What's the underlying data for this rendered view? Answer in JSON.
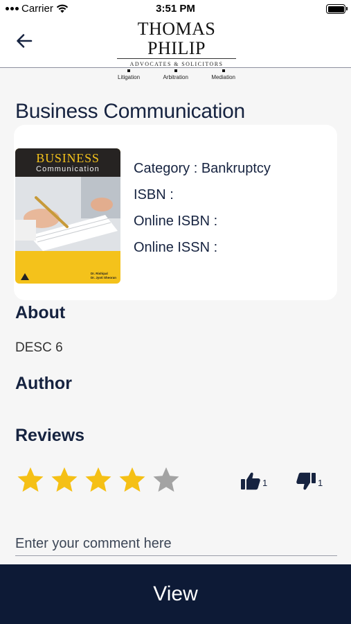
{
  "status_bar": {
    "carrier": "Carrier",
    "time": "3:51 PM"
  },
  "header": {
    "logo": {
      "name_first": "Thomas",
      "name_last": "Philip",
      "subtitle": "ADVOCATES & SOLICITORS",
      "services": [
        "Litigation",
        "Arbitration",
        "Mediation"
      ]
    },
    "back_icon": "arrow-left-icon"
  },
  "book": {
    "title": "Business Communication",
    "cover": {
      "title": "BUSINESS",
      "subtitle": "Communication",
      "author1": "Dr. Rishipal",
      "author2": "Dr. Jyoti Sheoran"
    },
    "category_line": "Category : Bankruptcy",
    "isbn_label": "ISBN :",
    "online_isbn_label": "Online ISBN :",
    "online_issn_label": "Online ISSN :"
  },
  "about": {
    "heading": "About",
    "description": "DESC 6"
  },
  "author": {
    "heading": "Author"
  },
  "reviews": {
    "heading": "Reviews",
    "rating": 4,
    "max_rating": 5,
    "likes": "1",
    "dislikes": "1"
  },
  "comment": {
    "placeholder": "Enter your comment here"
  },
  "actions": {
    "view_label": "View"
  },
  "colors": {
    "primary": "#0d1a36",
    "star_filled": "#f5c016",
    "star_empty": "#a3a3a3",
    "text": "#162340"
  }
}
